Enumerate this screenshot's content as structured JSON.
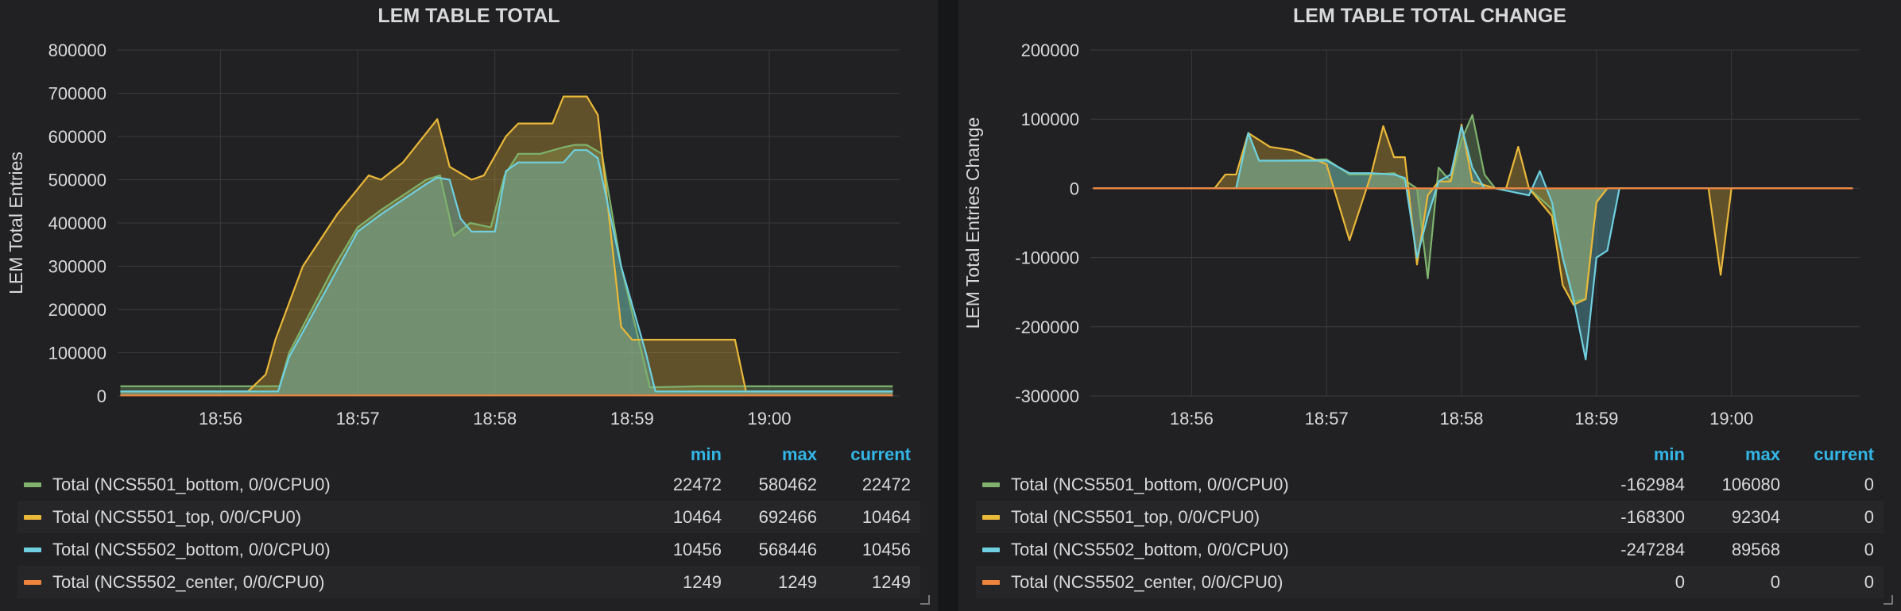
{
  "panels": [
    {
      "title": "LEM TABLE TOTAL",
      "legend_headers": {
        "min": "min",
        "max": "max",
        "current": "current"
      },
      "legend": [
        {
          "name": "Total (NCS5501_bottom, 0/0/CPU0)",
          "min": "22472",
          "max": "580462",
          "current": "22472",
          "color": "#7eb26d"
        },
        {
          "name": "Total (NCS5501_top, 0/0/CPU0)",
          "min": "10464",
          "max": "692466",
          "current": "10464",
          "color": "#eab839"
        },
        {
          "name": "Total (NCS5502_bottom, 0/0/CPU0)",
          "min": "10456",
          "max": "568446",
          "current": "10456",
          "color": "#6ed0e0"
        },
        {
          "name": "Total (NCS5502_center, 0/0/CPU0)",
          "min": "1249",
          "max": "1249",
          "current": "1249",
          "color": "#ef843c"
        }
      ]
    },
    {
      "title": "LEM TABLE TOTAL CHANGE",
      "legend_headers": {
        "min": "min",
        "max": "max",
        "current": "current"
      },
      "legend": [
        {
          "name": "Total (NCS5501_bottom, 0/0/CPU0)",
          "min": "-162984",
          "max": "106080",
          "current": "0",
          "color": "#7eb26d"
        },
        {
          "name": "Total (NCS5501_top, 0/0/CPU0)",
          "min": "-168300",
          "max": "92304",
          "current": "0",
          "color": "#eab839"
        },
        {
          "name": "Total (NCS5502_bottom, 0/0/CPU0)",
          "min": "-247284",
          "max": "89568",
          "current": "0",
          "color": "#6ed0e0"
        },
        {
          "name": "Total (NCS5502_center, 0/0/CPU0)",
          "min": "0",
          "max": "0",
          "current": "0",
          "color": "#ef843c"
        }
      ]
    }
  ],
  "chart_data": [
    {
      "type": "area",
      "title": "LEM TABLE TOTAL",
      "ylabel": "LEM Total Entries",
      "xlabel": "",
      "xlim": [
        "18:55.25",
        "19:00.95"
      ],
      "x_ticks": [
        "18:56",
        "18:57",
        "18:58",
        "18:59",
        "19:00"
      ],
      "x_tick_values": [
        56,
        57,
        58,
        59,
        60
      ],
      "xlim_minutes": [
        55.25,
        60.95
      ],
      "ylim": [
        0,
        800000
      ],
      "y_ticks": [
        "0",
        "100000",
        "200000",
        "300000",
        "400000",
        "500000",
        "600000",
        "700000",
        "800000"
      ],
      "grid": true,
      "series": [
        {
          "name": "Total (NCS5501_bottom, 0/0/CPU0)",
          "color": "#7eb26d",
          "x": [
            55.27,
            56.0,
            56.3,
            56.43,
            56.5,
            56.83,
            57.0,
            57.17,
            57.5,
            57.6,
            57.7,
            57.82,
            57.97,
            58.07,
            58.17,
            58.33,
            58.5,
            58.58,
            58.67,
            58.78,
            58.92,
            59.13,
            59.5,
            60.0,
            60.9
          ],
          "y": [
            22472,
            22472,
            22472,
            22472,
            100000,
            300000,
            390000,
            430000,
            500000,
            510000,
            370000,
            400000,
            390000,
            510000,
            560000,
            560000,
            575000,
            580462,
            580462,
            560000,
            300000,
            20000,
            22472,
            22472,
            22472
          ]
        },
        {
          "name": "Total (NCS5501_top, 0/0/CPU0)",
          "color": "#eab839",
          "x": [
            55.27,
            56.0,
            56.2,
            56.33,
            56.4,
            56.6,
            56.85,
            57.08,
            57.17,
            57.33,
            57.58,
            57.67,
            57.83,
            57.92,
            58.08,
            58.17,
            58.25,
            58.42,
            58.5,
            58.67,
            58.75,
            58.92,
            59.0,
            59.17,
            59.5,
            59.75,
            59.83,
            60.0,
            60.9
          ],
          "y": [
            10464,
            10464,
            10464,
            50000,
            130000,
            300000,
            420000,
            510000,
            500000,
            540000,
            640000,
            530000,
            500000,
            510000,
            600000,
            630000,
            630000,
            630000,
            692466,
            692466,
            650000,
            160000,
            130000,
            130000,
            130000,
            130000,
            10464,
            10464,
            10464
          ]
        },
        {
          "name": "Total (NCS5502_bottom, 0/0/CPU0)",
          "color": "#6ed0e0",
          "x": [
            55.27,
            56.0,
            56.3,
            56.42,
            56.5,
            56.83,
            57.0,
            57.17,
            57.5,
            57.58,
            57.67,
            57.75,
            57.83,
            58.0,
            58.08,
            58.17,
            58.33,
            58.5,
            58.58,
            58.67,
            58.75,
            58.92,
            59.1,
            59.17,
            59.5,
            60.0,
            60.9
          ],
          "y": [
            10456,
            10456,
            10456,
            10456,
            90000,
            280000,
            380000,
            420000,
            490000,
            505000,
            500000,
            410000,
            380000,
            380000,
            520000,
            540000,
            540000,
            540000,
            568446,
            568446,
            550000,
            300000,
            100000,
            10456,
            10456,
            10456,
            10456
          ]
        },
        {
          "name": "Total (NCS5502_center, 0/0/CPU0)",
          "color": "#ef843c",
          "x": [
            55.27,
            60.9
          ],
          "y": [
            1249,
            1249
          ]
        }
      ]
    },
    {
      "type": "area",
      "title": "LEM TABLE TOTAL CHANGE",
      "ylabel": "LEM Total Entries Change",
      "xlabel": "",
      "xlim_minutes": [
        55.25,
        60.95
      ],
      "x_ticks": [
        "18:56",
        "18:57",
        "18:58",
        "18:59",
        "19:00"
      ],
      "x_tick_values": [
        56,
        57,
        58,
        59,
        60
      ],
      "ylim": [
        -300000,
        200000
      ],
      "y_ticks": [
        "-300000",
        "-200000",
        "-100000",
        "0",
        "100000",
        "200000"
      ],
      "y_tick_values": [
        -300000,
        -200000,
        -100000,
        0,
        100000,
        200000
      ],
      "grid": true,
      "series": [
        {
          "name": "Total (NCS5501_bottom, 0/0/CPU0)",
          "color": "#7eb26d",
          "x": [
            55.27,
            56.25,
            56.33,
            56.42,
            56.5,
            56.67,
            57.0,
            57.17,
            57.33,
            57.5,
            57.67,
            57.75,
            57.83,
            57.92,
            58.0,
            58.08,
            58.17,
            58.25,
            58.5,
            58.67,
            58.75,
            58.83,
            58.92,
            59.0,
            59.08,
            59.17,
            59.5,
            60.0,
            60.9
          ],
          "y": [
            0,
            0,
            0,
            80000,
            40000,
            40000,
            42000,
            20000,
            20000,
            22000,
            0,
            -130000,
            30000,
            10000,
            70000,
            106080,
            20000,
            0,
            0,
            -30000,
            -100000,
            -162984,
            -160000,
            -20000,
            0,
            0,
            0,
            0,
            0
          ]
        },
        {
          "name": "Total (NCS5501_top, 0/0/CPU0)",
          "color": "#eab839",
          "x": [
            55.27,
            56.17,
            56.25,
            56.33,
            56.42,
            56.58,
            56.75,
            57.0,
            57.17,
            57.33,
            57.42,
            57.5,
            57.58,
            57.67,
            57.75,
            57.83,
            57.92,
            58.0,
            58.08,
            58.25,
            58.33,
            58.42,
            58.5,
            58.67,
            58.75,
            58.83,
            58.92,
            59.0,
            59.08,
            59.17,
            59.67,
            59.83,
            59.92,
            60.0,
            60.9
          ],
          "y": [
            0,
            0,
            20000,
            20000,
            80000,
            60000,
            55000,
            35000,
            -75000,
            20000,
            90000,
            45000,
            45000,
            -110000,
            -10000,
            10000,
            10000,
            92304,
            10000,
            0,
            0,
            60000,
            0,
            -40000,
            -140000,
            -168300,
            -160000,
            -20000,
            0,
            0,
            0,
            0,
            -125000,
            0,
            0
          ]
        },
        {
          "name": "Total (NCS5502_bottom, 0/0/CPU0)",
          "color": "#6ed0e0",
          "x": [
            55.27,
            56.25,
            56.33,
            56.42,
            56.5,
            56.67,
            57.0,
            57.17,
            57.33,
            57.5,
            57.58,
            57.67,
            57.75,
            57.83,
            57.92,
            58.0,
            58.08,
            58.17,
            58.25,
            58.5,
            58.58,
            58.67,
            58.75,
            58.83,
            58.92,
            59.0,
            59.08,
            59.17,
            59.5,
            60.0,
            60.9
          ],
          "y": [
            0,
            0,
            0,
            80000,
            40000,
            40000,
            40000,
            22000,
            22000,
            20000,
            15000,
            -100000,
            -40000,
            10000,
            20000,
            89568,
            30000,
            0,
            0,
            -10000,
            25000,
            -20000,
            -100000,
            -160000,
            -247284,
            -100000,
            -90000,
            0,
            0,
            0,
            0
          ]
        },
        {
          "name": "Total (NCS5502_center, 0/0/CPU0)",
          "color": "#ef843c",
          "x": [
            55.27,
            60.9
          ],
          "y": [
            0,
            0
          ]
        }
      ]
    }
  ]
}
